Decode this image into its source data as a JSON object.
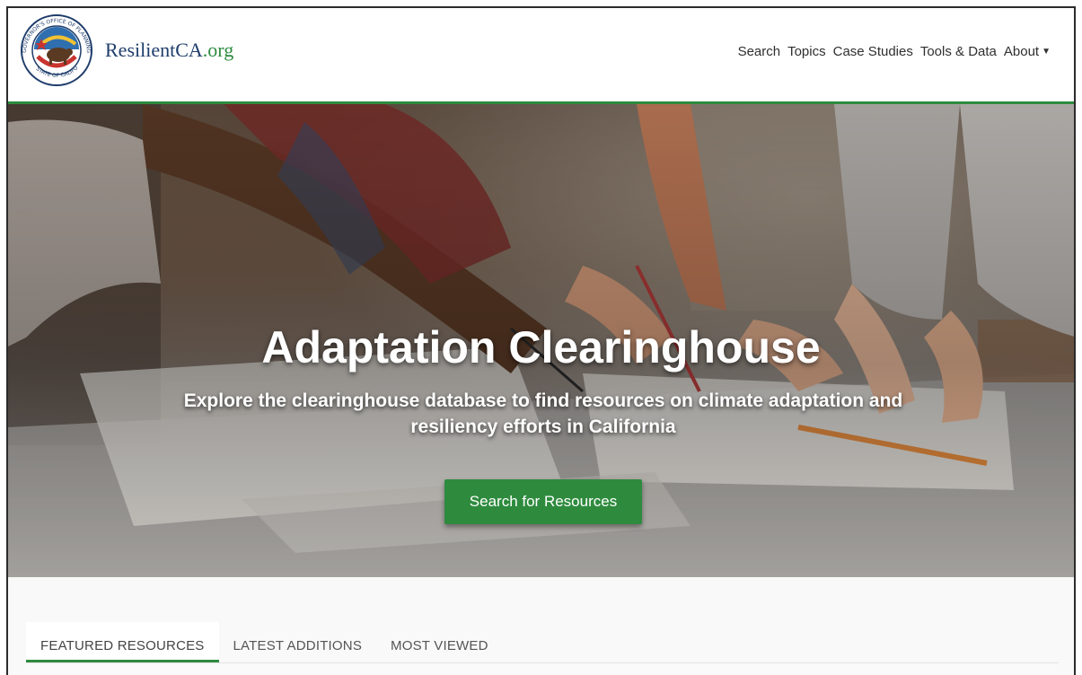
{
  "brand": {
    "name": "ResilientCA",
    "tld": ".org"
  },
  "seal": {
    "top_text": "GOVERNOR'S OFFICE OF PLANNING AND RESEARCH",
    "bottom_text": "STATE OF CALIFORNIA"
  },
  "nav": {
    "items": [
      {
        "label": "Search"
      },
      {
        "label": "Topics"
      },
      {
        "label": "Case Studies"
      },
      {
        "label": "Tools & Data"
      },
      {
        "label": "About",
        "has_dropdown": true
      }
    ]
  },
  "hero": {
    "title": "Adaptation Clearinghouse",
    "subtitle": "Explore the clearinghouse database to find resources on climate adaptation and resiliency efforts in California",
    "button_label": "Search for Resources"
  },
  "tabs": [
    {
      "label": "FEATURED RESOURCES",
      "active": true
    },
    {
      "label": "LATEST ADDITIONS",
      "active": false
    },
    {
      "label": "MOST VIEWED",
      "active": false
    }
  ],
  "colors": {
    "accent": "#2e8b3e",
    "brand_text": "#1f3d6b"
  }
}
